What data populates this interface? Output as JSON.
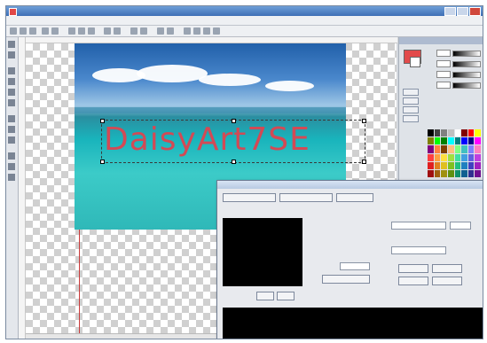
{
  "canvas_text": "DaisyArt7SE",
  "colors": {
    "accent_red": "#e24b4b",
    "text_red": "#d24a55",
    "title_blue": "#3e6fb5",
    "sea": "#19b4bc",
    "sky": "#1f5ea8"
  },
  "palette": [
    "#000000",
    "#404040",
    "#808080",
    "#c0c0c0",
    "#ffffff",
    "#800000",
    "#ff0000",
    "#ffff00",
    "#808000",
    "#00ff00",
    "#008000",
    "#00ffff",
    "#008080",
    "#0000ff",
    "#000080",
    "#ff00ff",
    "#800080",
    "#ff8040",
    "#804000",
    "#ffc080",
    "#80ff80",
    "#40c0c0",
    "#8080ff",
    "#ff80c0",
    "#ff4040",
    "#ffa040",
    "#ffe040",
    "#a0e040",
    "#40e0a0",
    "#40a0e0",
    "#6060e0",
    "#c040e0",
    "#e02020",
    "#e08020",
    "#e0c020",
    "#80c020",
    "#20c080",
    "#2080c0",
    "#4040c0",
    "#a020c0",
    "#a01010",
    "#a06010",
    "#a09010",
    "#609010",
    "#10906a",
    "#106090",
    "#303090",
    "#701090"
  ],
  "icons": [
    "app-icon",
    "minimize-icon",
    "maximize-icon",
    "close-icon",
    "select-tool-icon",
    "move-tool-icon",
    "text-tool-icon",
    "pen-tool-icon",
    "brush-tool-icon",
    "eraser-tool-icon",
    "fill-tool-icon",
    "zoom-tool-icon"
  ]
}
